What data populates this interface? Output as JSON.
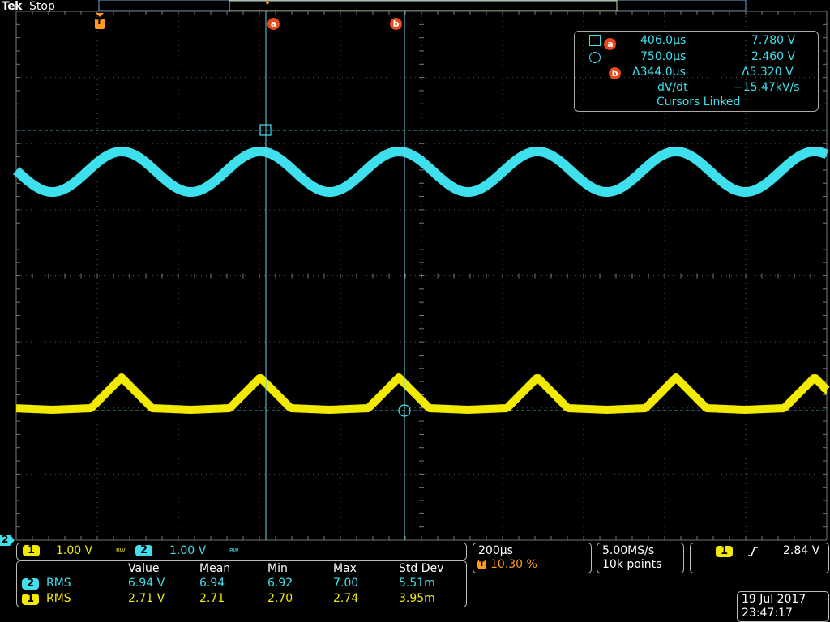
{
  "header": {
    "brand": "Tek",
    "run_state": "Stop"
  },
  "markers": {
    "trigger": "T",
    "cursor_a": "a",
    "cursor_b": "b",
    "ch2_ground": "2"
  },
  "cursor_readout": {
    "row_a": {
      "time": "406.0µs",
      "volts": "7.780 V"
    },
    "row_b": {
      "time": "750.0µs",
      "volts": "2.460 V"
    },
    "delta": {
      "time": "Δ344.0µs",
      "volts": "Δ5.320 V"
    },
    "slope": {
      "label": "dV/dt",
      "value": "−15.47kV/s"
    },
    "linked": "Cursors Linked"
  },
  "channels": {
    "ch1": {
      "num": "1",
      "scale": "1.00 V",
      "bw": "BW"
    },
    "ch2": {
      "num": "2",
      "scale": "1.00 V",
      "bw": "BW"
    }
  },
  "measurements": {
    "headers": [
      "Value",
      "Mean",
      "Min",
      "Max",
      "Std Dev"
    ],
    "rows": [
      {
        "ch": "2",
        "type": "RMS",
        "value": "6.94 V",
        "mean": "6.94",
        "min": "6.92",
        "max": "7.00",
        "std": "5.51m"
      },
      {
        "ch": "1",
        "type": "RMS",
        "value": "2.71 V",
        "mean": "2.71",
        "min": "2.70",
        "max": "2.74",
        "std": "3.95m"
      }
    ]
  },
  "horizontal": {
    "scale": "200µs",
    "trigger_pos": "10.30 %"
  },
  "acquisition": {
    "rate": "5.00MS/s",
    "points": "10k points"
  },
  "trigger": {
    "ch": "1",
    "slope_icon": "rising-edge-icon",
    "level": "2.84 V"
  },
  "datetime": {
    "date": "19 Jul  2017",
    "time": "23:47:17"
  },
  "colors": {
    "ch1": "#f2ea00",
    "ch2": "#3ee0ee",
    "marker": "#ff9a1f",
    "cursor_tag": "#e84a1a"
  }
}
